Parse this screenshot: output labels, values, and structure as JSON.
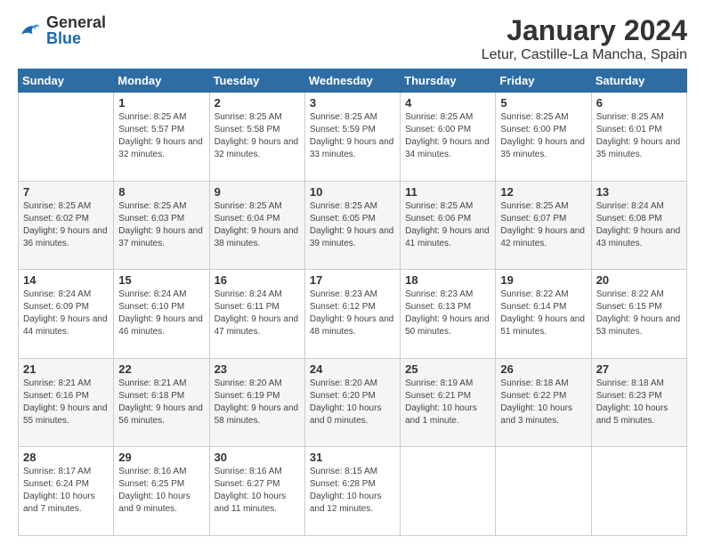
{
  "header": {
    "logo": {
      "general": "General",
      "blue": "Blue"
    },
    "title": "January 2024",
    "location": "Letur, Castille-La Mancha, Spain"
  },
  "days_header": [
    "Sunday",
    "Monday",
    "Tuesday",
    "Wednesday",
    "Thursday",
    "Friday",
    "Saturday"
  ],
  "weeks": [
    [
      {
        "day": "",
        "sunrise": "",
        "sunset": "",
        "daylight": ""
      },
      {
        "day": "1",
        "sunrise": "Sunrise: 8:25 AM",
        "sunset": "Sunset: 5:57 PM",
        "daylight": "Daylight: 9 hours and 32 minutes."
      },
      {
        "day": "2",
        "sunrise": "Sunrise: 8:25 AM",
        "sunset": "Sunset: 5:58 PM",
        "daylight": "Daylight: 9 hours and 32 minutes."
      },
      {
        "day": "3",
        "sunrise": "Sunrise: 8:25 AM",
        "sunset": "Sunset: 5:59 PM",
        "daylight": "Daylight: 9 hours and 33 minutes."
      },
      {
        "day": "4",
        "sunrise": "Sunrise: 8:25 AM",
        "sunset": "Sunset: 6:00 PM",
        "daylight": "Daylight: 9 hours and 34 minutes."
      },
      {
        "day": "5",
        "sunrise": "Sunrise: 8:25 AM",
        "sunset": "Sunset: 6:00 PM",
        "daylight": "Daylight: 9 hours and 35 minutes."
      },
      {
        "day": "6",
        "sunrise": "Sunrise: 8:25 AM",
        "sunset": "Sunset: 6:01 PM",
        "daylight": "Daylight: 9 hours and 35 minutes."
      }
    ],
    [
      {
        "day": "7",
        "sunrise": "Sunrise: 8:25 AM",
        "sunset": "Sunset: 6:02 PM",
        "daylight": "Daylight: 9 hours and 36 minutes."
      },
      {
        "day": "8",
        "sunrise": "Sunrise: 8:25 AM",
        "sunset": "Sunset: 6:03 PM",
        "daylight": "Daylight: 9 hours and 37 minutes."
      },
      {
        "day": "9",
        "sunrise": "Sunrise: 8:25 AM",
        "sunset": "Sunset: 6:04 PM",
        "daylight": "Daylight: 9 hours and 38 minutes."
      },
      {
        "day": "10",
        "sunrise": "Sunrise: 8:25 AM",
        "sunset": "Sunset: 6:05 PM",
        "daylight": "Daylight: 9 hours and 39 minutes."
      },
      {
        "day": "11",
        "sunrise": "Sunrise: 8:25 AM",
        "sunset": "Sunset: 6:06 PM",
        "daylight": "Daylight: 9 hours and 41 minutes."
      },
      {
        "day": "12",
        "sunrise": "Sunrise: 8:25 AM",
        "sunset": "Sunset: 6:07 PM",
        "daylight": "Daylight: 9 hours and 42 minutes."
      },
      {
        "day": "13",
        "sunrise": "Sunrise: 8:24 AM",
        "sunset": "Sunset: 6:08 PM",
        "daylight": "Daylight: 9 hours and 43 minutes."
      }
    ],
    [
      {
        "day": "14",
        "sunrise": "Sunrise: 8:24 AM",
        "sunset": "Sunset: 6:09 PM",
        "daylight": "Daylight: 9 hours and 44 minutes."
      },
      {
        "day": "15",
        "sunrise": "Sunrise: 8:24 AM",
        "sunset": "Sunset: 6:10 PM",
        "daylight": "Daylight: 9 hours and 46 minutes."
      },
      {
        "day": "16",
        "sunrise": "Sunrise: 8:24 AM",
        "sunset": "Sunset: 6:11 PM",
        "daylight": "Daylight: 9 hours and 47 minutes."
      },
      {
        "day": "17",
        "sunrise": "Sunrise: 8:23 AM",
        "sunset": "Sunset: 6:12 PM",
        "daylight": "Daylight: 9 hours and 48 minutes."
      },
      {
        "day": "18",
        "sunrise": "Sunrise: 8:23 AM",
        "sunset": "Sunset: 6:13 PM",
        "daylight": "Daylight: 9 hours and 50 minutes."
      },
      {
        "day": "19",
        "sunrise": "Sunrise: 8:22 AM",
        "sunset": "Sunset: 6:14 PM",
        "daylight": "Daylight: 9 hours and 51 minutes."
      },
      {
        "day": "20",
        "sunrise": "Sunrise: 8:22 AM",
        "sunset": "Sunset: 6:15 PM",
        "daylight": "Daylight: 9 hours and 53 minutes."
      }
    ],
    [
      {
        "day": "21",
        "sunrise": "Sunrise: 8:21 AM",
        "sunset": "Sunset: 6:16 PM",
        "daylight": "Daylight: 9 hours and 55 minutes."
      },
      {
        "day": "22",
        "sunrise": "Sunrise: 8:21 AM",
        "sunset": "Sunset: 6:18 PM",
        "daylight": "Daylight: 9 hours and 56 minutes."
      },
      {
        "day": "23",
        "sunrise": "Sunrise: 8:20 AM",
        "sunset": "Sunset: 6:19 PM",
        "daylight": "Daylight: 9 hours and 58 minutes."
      },
      {
        "day": "24",
        "sunrise": "Sunrise: 8:20 AM",
        "sunset": "Sunset: 6:20 PM",
        "daylight": "Daylight: 10 hours and 0 minutes."
      },
      {
        "day": "25",
        "sunrise": "Sunrise: 8:19 AM",
        "sunset": "Sunset: 6:21 PM",
        "daylight": "Daylight: 10 hours and 1 minute."
      },
      {
        "day": "26",
        "sunrise": "Sunrise: 8:18 AM",
        "sunset": "Sunset: 6:22 PM",
        "daylight": "Daylight: 10 hours and 3 minutes."
      },
      {
        "day": "27",
        "sunrise": "Sunrise: 8:18 AM",
        "sunset": "Sunset: 6:23 PM",
        "daylight": "Daylight: 10 hours and 5 minutes."
      }
    ],
    [
      {
        "day": "28",
        "sunrise": "Sunrise: 8:17 AM",
        "sunset": "Sunset: 6:24 PM",
        "daylight": "Daylight: 10 hours and 7 minutes."
      },
      {
        "day": "29",
        "sunrise": "Sunrise: 8:16 AM",
        "sunset": "Sunset: 6:25 PM",
        "daylight": "Daylight: 10 hours and 9 minutes."
      },
      {
        "day": "30",
        "sunrise": "Sunrise: 8:16 AM",
        "sunset": "Sunset: 6:27 PM",
        "daylight": "Daylight: 10 hours and 11 minutes."
      },
      {
        "day": "31",
        "sunrise": "Sunrise: 8:15 AM",
        "sunset": "Sunset: 6:28 PM",
        "daylight": "Daylight: 10 hours and 12 minutes."
      },
      {
        "day": "",
        "sunrise": "",
        "sunset": "",
        "daylight": ""
      },
      {
        "day": "",
        "sunrise": "",
        "sunset": "",
        "daylight": ""
      },
      {
        "day": "",
        "sunrise": "",
        "sunset": "",
        "daylight": ""
      }
    ]
  ]
}
